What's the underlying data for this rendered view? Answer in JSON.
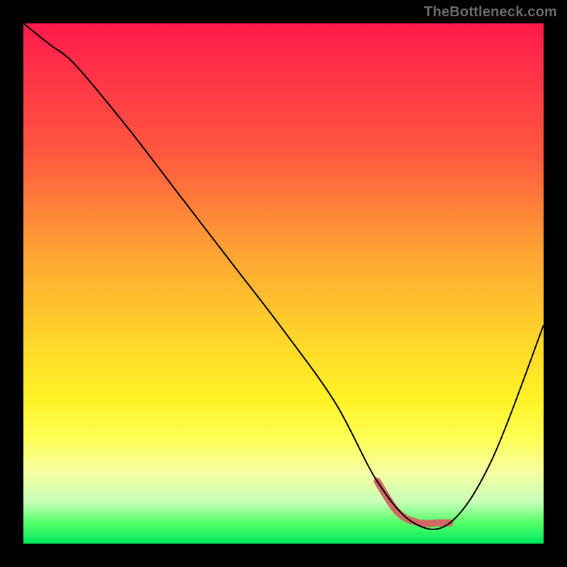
{
  "watermark": "TheBottleneck.com",
  "chart_data": {
    "type": "line",
    "title": "",
    "xlabel": "",
    "ylabel": "",
    "xlim": [
      0,
      100
    ],
    "ylim": [
      0,
      100
    ],
    "grid": false,
    "legend": false,
    "series": [
      {
        "name": "bottleneck-curve",
        "x": [
          0,
          5,
          10,
          20,
          30,
          40,
          50,
          60,
          68,
          75,
          82,
          90,
          100
        ],
        "values": [
          100,
          96,
          92,
          80,
          67,
          54,
          41,
          27,
          12,
          4,
          4,
          16,
          42
        ]
      }
    ],
    "annotations": [
      {
        "name": "optimal-zone",
        "x": [
          68,
          72,
          76,
          80,
          82
        ],
        "values": [
          12,
          6,
          4,
          4,
          4
        ]
      }
    ],
    "gradient_colors": {
      "top": "#ff1a4b",
      "mid1": "#ffa733",
      "mid2": "#fff225",
      "bottom": "#00e85e"
    }
  }
}
